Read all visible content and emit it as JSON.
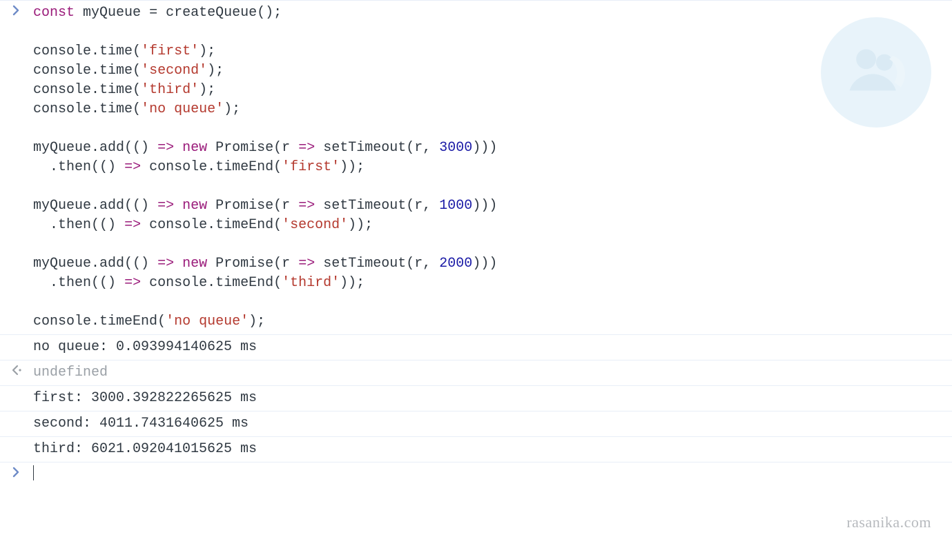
{
  "watermark_brand": "rasanika.com",
  "code": {
    "kw_const": "const",
    "id_myQueue": "myQueue",
    "eq": "=",
    "fn_createQueue": "createQueue",
    "console": "console",
    "time": "time",
    "timeEnd": "timeEnd",
    "str_first": "'first'",
    "str_second": "'second'",
    "str_third": "'third'",
    "str_no_queue": "'no queue'",
    "id_add": "add",
    "kw_new": "new",
    "cls_Promise": "Promise",
    "id_r": "r",
    "fn_setTimeout": "setTimeout",
    "num_3000": "3000",
    "num_1000": "1000",
    "num_2000": "2000",
    "then": "then",
    "arrow": "=>"
  },
  "outputs": {
    "no_queue": "no queue: 0.093994140625 ms",
    "undefined": "undefined",
    "first": "first: 3000.392822265625 ms",
    "second": "second: 4011.7431640625 ms",
    "third": "third: 6021.092041015625 ms"
  },
  "prompts": {
    "input_marker": "›",
    "output_marker": "‹·"
  }
}
